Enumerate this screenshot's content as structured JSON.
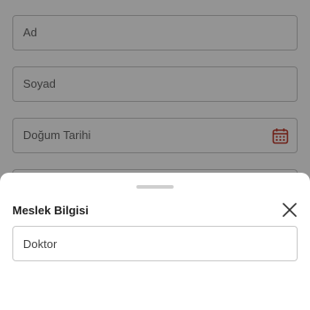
{
  "form": {
    "fields": [
      {
        "label": "Ad"
      },
      {
        "label": "Soyad"
      },
      {
        "label": "Doğum Tarihi",
        "icon": "calendar-icon"
      }
    ],
    "accent": "#c0392b"
  },
  "sheet": {
    "title": "Meslek Bilgisi",
    "close_icon": "close-icon",
    "profession_value": "Doktor"
  }
}
